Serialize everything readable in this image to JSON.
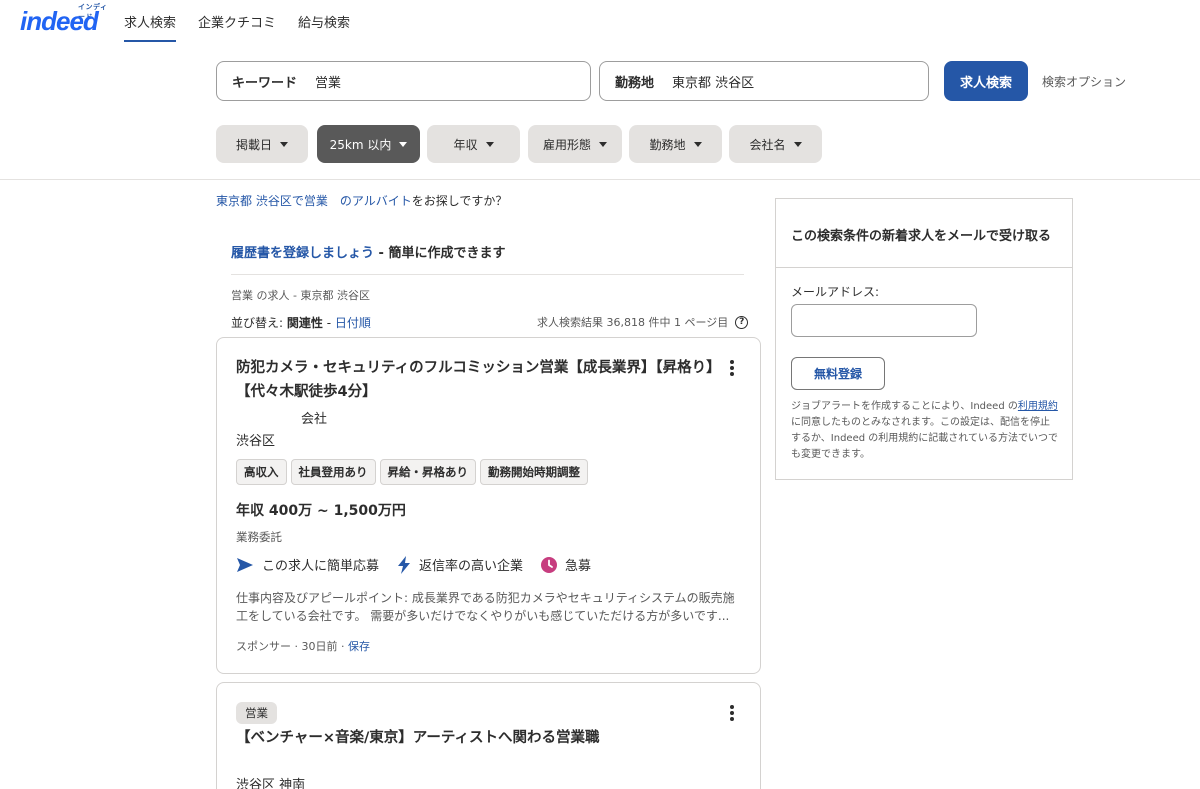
{
  "header": {
    "logo_kana": "インディード",
    "logo_text": "indeed",
    "nav": [
      "求人検索",
      "企業クチコミ",
      "給与検索"
    ]
  },
  "search": {
    "keyword_label": "キーワード",
    "keyword_value": "営業",
    "location_label": "勤務地",
    "location_value": "東京都 渋谷区",
    "button_label": "求人検索",
    "options_label": "検索オプション"
  },
  "filters": [
    "掲載日",
    "25km 以内",
    "年収",
    "雇用形態",
    "勤務地",
    "会社名"
  ],
  "suggest": {
    "link": "東京都 渋谷区で営業　のアルバイト",
    "text": "をお探しですか？"
  },
  "resume": {
    "link": "履歴書を登録しましょう",
    "text": " - 簡単に作成できます"
  },
  "breadcrumb": "営業 の求人 - 東京都 渋谷区",
  "sort": {
    "label": "並び替え: ",
    "active": "関連性",
    "sep": " - ",
    "other": "日付順"
  },
  "result_count": "求人検索結果 36,818 件中 1 ページ目",
  "jobs": [
    {
      "title": "防犯カメラ・セキュリティのフルコミッション営業【成長業界】【昇格り】【代々木駅徒歩4分】",
      "company": "会社",
      "location": "渋谷区",
      "tags": [
        "高収入",
        "社員登用あり",
        "昇給・昇格あり",
        "勤務開始時期調整"
      ],
      "salary": "年収 400万 ~ 1,500万円",
      "job_type": "業務委託",
      "features": [
        "この求人に簡単応募",
        "返信率の高い企業",
        "急募"
      ],
      "snippet": "仕事内容及びアピールポイント: 成長業界である防犯カメラやセキュリティシステムの販売施工をしている会社です。 需要が多いだけでなくやりがいも感じていただける方が多いです...",
      "meta_sponsor": "スポンサー",
      "meta_date": "30日前",
      "meta_save": "保存"
    },
    {
      "badge": "営業",
      "title": "【ベンチャー×音楽/東京】アーティストへ関わる営業職",
      "location": "渋谷区 神南"
    }
  ],
  "alert": {
    "title": "この検索条件の新着求人をメールで受け取る",
    "email_label": "メールアドレス:",
    "button_label": "無料登録",
    "disclaimer_1": "ジョブアラートを作成することにより、Indeed の",
    "disclaimer_link": "利用規約",
    "disclaimer_2": "に同意したものとみなされます。この設定は、配信を停止するか、Indeed の利用規約に記載されている方法でいつでも変更できます。"
  },
  "colors": {
    "brand": "#2557a7",
    "logo": "#2164f3",
    "urgent": "#c73d7f"
  }
}
